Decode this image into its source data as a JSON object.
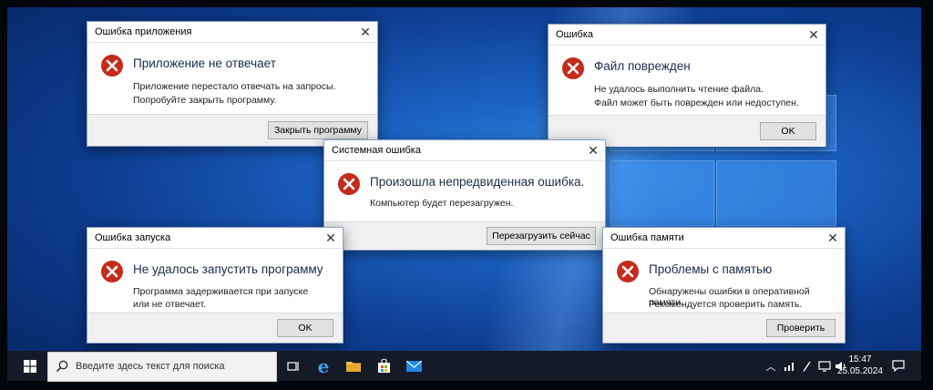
{
  "dialogs": {
    "app_error": {
      "title": "Ошибка приложения",
      "heading": "Приложение не отвечает",
      "lines": [
        "Приложение перестало отвечать на запросы.",
        "Попробуйте закрыть программу."
      ],
      "button": "Закрыть программу"
    },
    "file_error": {
      "title": "Ошибка",
      "heading": "Файл поврежден",
      "lines": [
        "Не удалось выполнить чтение файла.",
        "Файл может быть поврежден или недоступен."
      ],
      "button": "OK"
    },
    "system_error": {
      "title": "Системная ошибка",
      "heading": "Произошла непредвиденная ошибка.",
      "lines": [
        "Компьютер будет перезагружен."
      ],
      "button": "Перезагрузить сейчас"
    },
    "launch_error": {
      "title": "Ошибка запуска",
      "heading": "Не удалось запустить программу",
      "lines": [
        "Программа задерживается при запуске",
        "или не отвечает."
      ],
      "button": "OK"
    },
    "memory_error": {
      "title": "Ошибка памяти",
      "heading": "Проблемы с памятью",
      "lines": [
        "Обнаружены ошибки в оперативной памяти.",
        "Рекомендуется проверить память."
      ],
      "button": "Проверить"
    }
  },
  "taskbar": {
    "search_placeholder": "Введите здесь текст для поиска",
    "time": "15:47",
    "date": "25.05.2024",
    "icons": [
      "windows-start-icon",
      "search-icon",
      "task-view-icon",
      "edge-icon",
      "file-explorer-icon",
      "store-icon",
      "mail-icon",
      "chevron-up-icon",
      "network-icon",
      "pen-icon",
      "display-icon",
      "volume-icon",
      "notification-icon"
    ]
  },
  "colors": {
    "error_red": "#c42b1c",
    "desktop_blue": "#1a5fbf",
    "taskbar": "#141a26"
  }
}
